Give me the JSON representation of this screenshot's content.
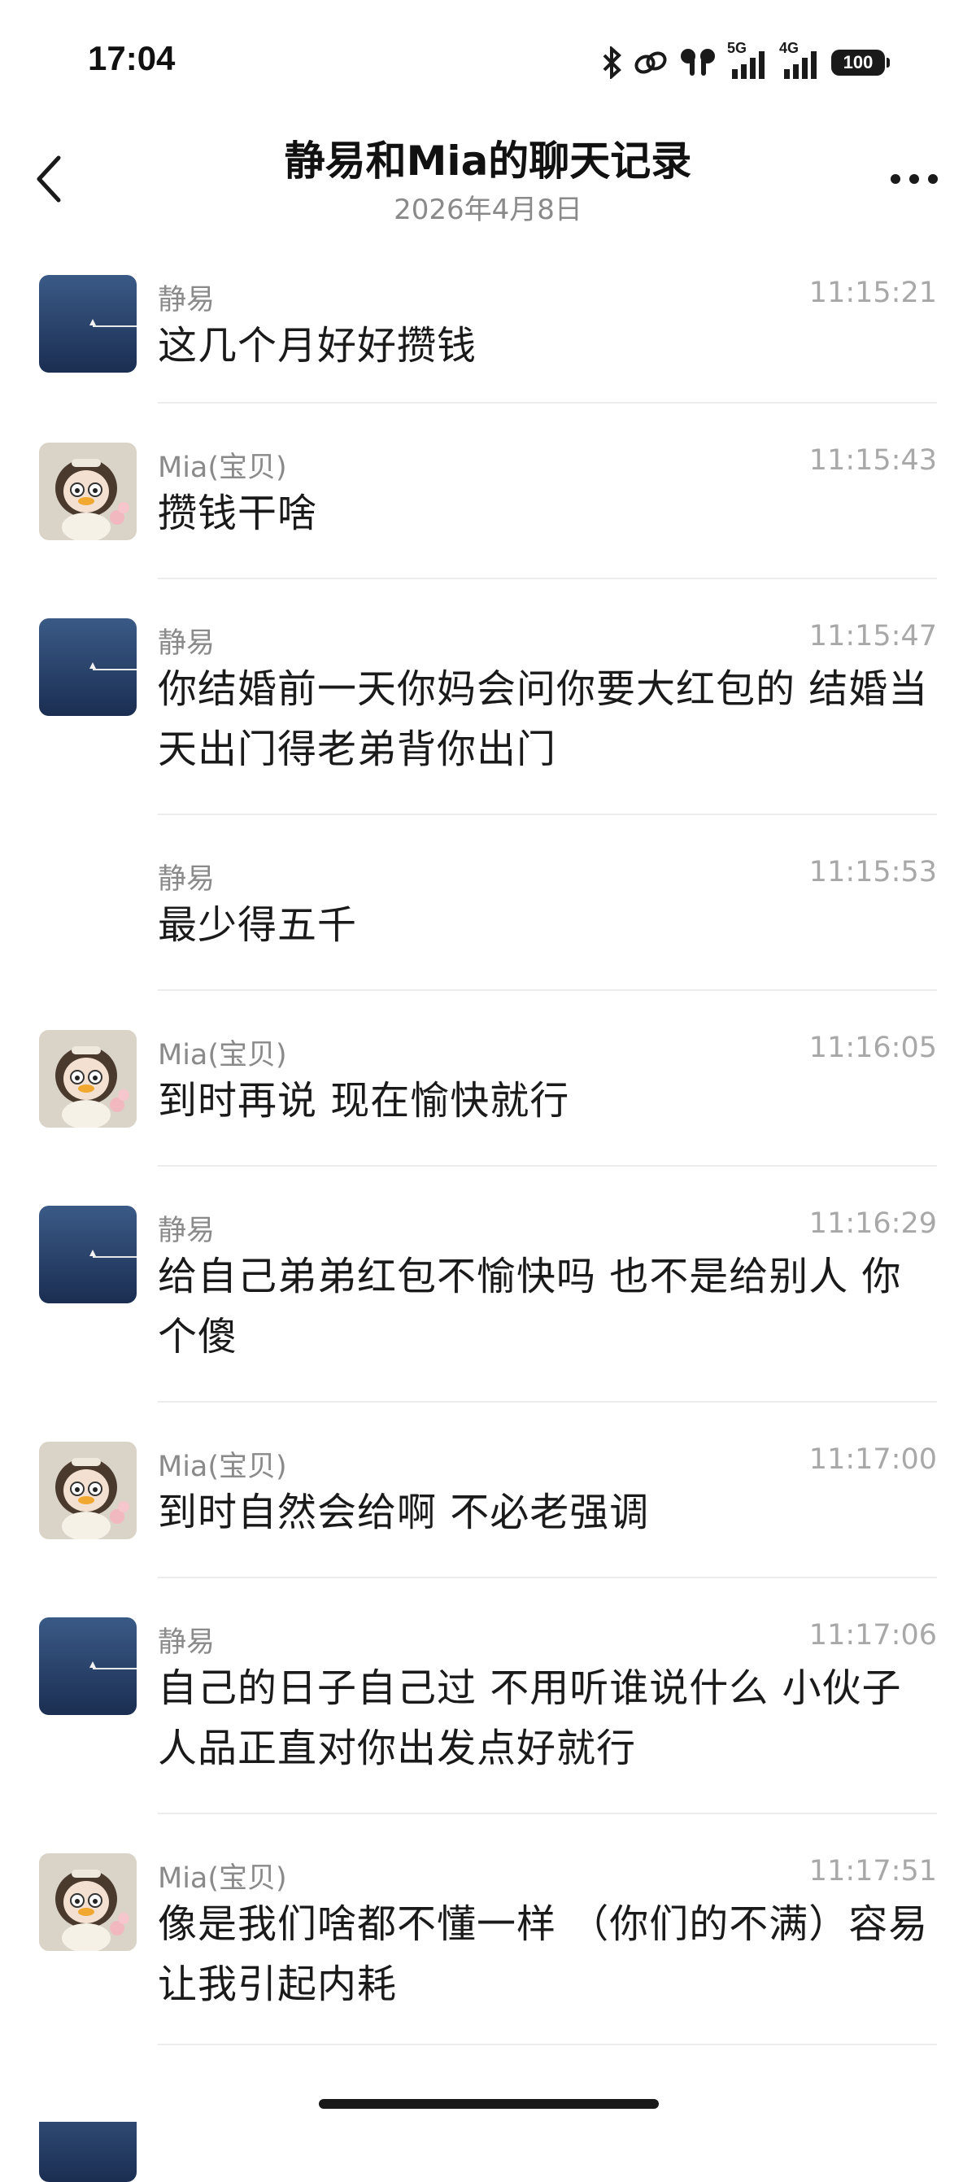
{
  "status": {
    "time": "17:04",
    "battery": "100",
    "network_5g": "5G",
    "network_4g": "4G"
  },
  "header": {
    "title": "静易和Mia的聊天记录",
    "subtitle": "2026年4月8日"
  },
  "messages": [
    {
      "sender": "静易",
      "time": "11:15:21",
      "text": "这几个月好好攒钱",
      "avatar": "sea"
    },
    {
      "sender": "Mia(宝贝)",
      "time": "11:15:43",
      "text": "攒钱干啥",
      "avatar": "doll"
    },
    {
      "sender": "静易",
      "time": "11:15:47",
      "text": "你结婚前一天你妈会问你要大红包的 结婚当天出门得老弟背你出门",
      "avatar": "sea"
    },
    {
      "sender": "静易",
      "time": "11:15:53",
      "text": "最少得五千",
      "avatar": "none"
    },
    {
      "sender": "Mia(宝贝)",
      "time": "11:16:05",
      "text": "到时再说 现在愉快就行",
      "avatar": "doll"
    },
    {
      "sender": "静易",
      "time": "11:16:29",
      "text": "给自己弟弟红包不愉快吗 也不是给别人 你个傻",
      "avatar": "sea"
    },
    {
      "sender": "Mia(宝贝)",
      "time": "11:17:00",
      "text": "到时自然会给啊 不必老强调",
      "avatar": "doll"
    },
    {
      "sender": "静易",
      "time": "11:17:06",
      "text": "自己的日子自己过 不用听谁说什么 小伙子人品正直对你出发点好就行",
      "avatar": "sea"
    },
    {
      "sender": "Mia(宝贝)",
      "time": "11:17:51",
      "text": "像是我们啥都不懂一样 （你们的不满）容易让我引起内耗",
      "avatar": "doll"
    },
    {
      "sender": "静易",
      "time": "",
      "text": "",
      "avatar": "sea"
    }
  ],
  "colors": {
    "muted_text": "#8a8a8a",
    "time_text": "#a8a8a8",
    "divider": "#ececec"
  }
}
